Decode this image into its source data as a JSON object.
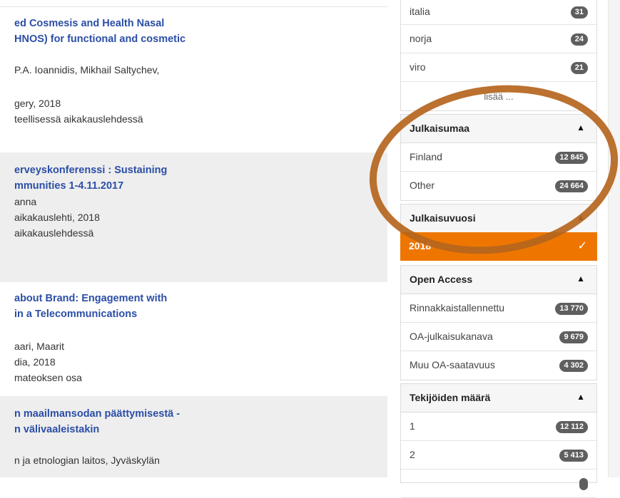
{
  "results": [
    {
      "title_lines": [
        "ed Cosmesis and Health Nasal",
        "HNOS) for functional and cosmetic"
      ],
      "lines": [
        "P.A. Ioannidis, Mikhail Saltychev,",
        "gery, 2018",
        "teellisessä aikakauslehdessä"
      ]
    },
    {
      "title_lines": [
        "erveyskonferenssi : Sustaining",
        "mmunities 1-4.11.2017"
      ],
      "lines": [
        "anna",
        "aikakauslehti, 2018",
        "aikakauslehdessä"
      ]
    },
    {
      "title_lines": [
        "about Brand: Engagement with",
        "in a Telecommunications"
      ],
      "lines": [
        "aari, Maarit",
        "dia, 2018",
        "mateoksen osa"
      ]
    },
    {
      "title_lines": [
        "n maailmansodan päättymisestä -",
        "n välivaaleistakin"
      ],
      "lines": [
        "n ja etnologian laitos, Jyväskylän"
      ]
    }
  ],
  "facets": {
    "country": {
      "items": [
        {
          "label": "italia",
          "count": "31"
        },
        {
          "label": "norja",
          "count": "24"
        },
        {
          "label": "viro",
          "count": "21"
        }
      ],
      "more_label": "lisää ..."
    },
    "publication_country": {
      "header": "Julkaisumaa",
      "items": [
        {
          "label": "Finland",
          "count": "12 845"
        },
        {
          "label": "Other",
          "count": "24 664"
        }
      ]
    },
    "publication_year": {
      "header": "Julkaisuvuosi",
      "selected": "2018"
    },
    "open_access": {
      "header": "Open Access",
      "items": [
        {
          "label": "Rinnakkaistallennettu",
          "count": "13 770"
        },
        {
          "label": "OA-julkaisukanava",
          "count": "9 679"
        },
        {
          "label": "Muu OA-saatavuus",
          "count": "4 302"
        }
      ]
    },
    "author_count": {
      "header": "Tekijöiden määrä",
      "items": [
        {
          "label": "1",
          "count": "12 112"
        },
        {
          "label": "2",
          "count": "5 413"
        }
      ]
    }
  },
  "colors": {
    "link": "#2b4ea6",
    "badge": "#5f5f5f",
    "selected": "#ee7600",
    "annotation": "#b5651d"
  },
  "icons": {
    "collapse": "triangle-up-icon",
    "selected_chevron": "chevron-down-icon"
  }
}
